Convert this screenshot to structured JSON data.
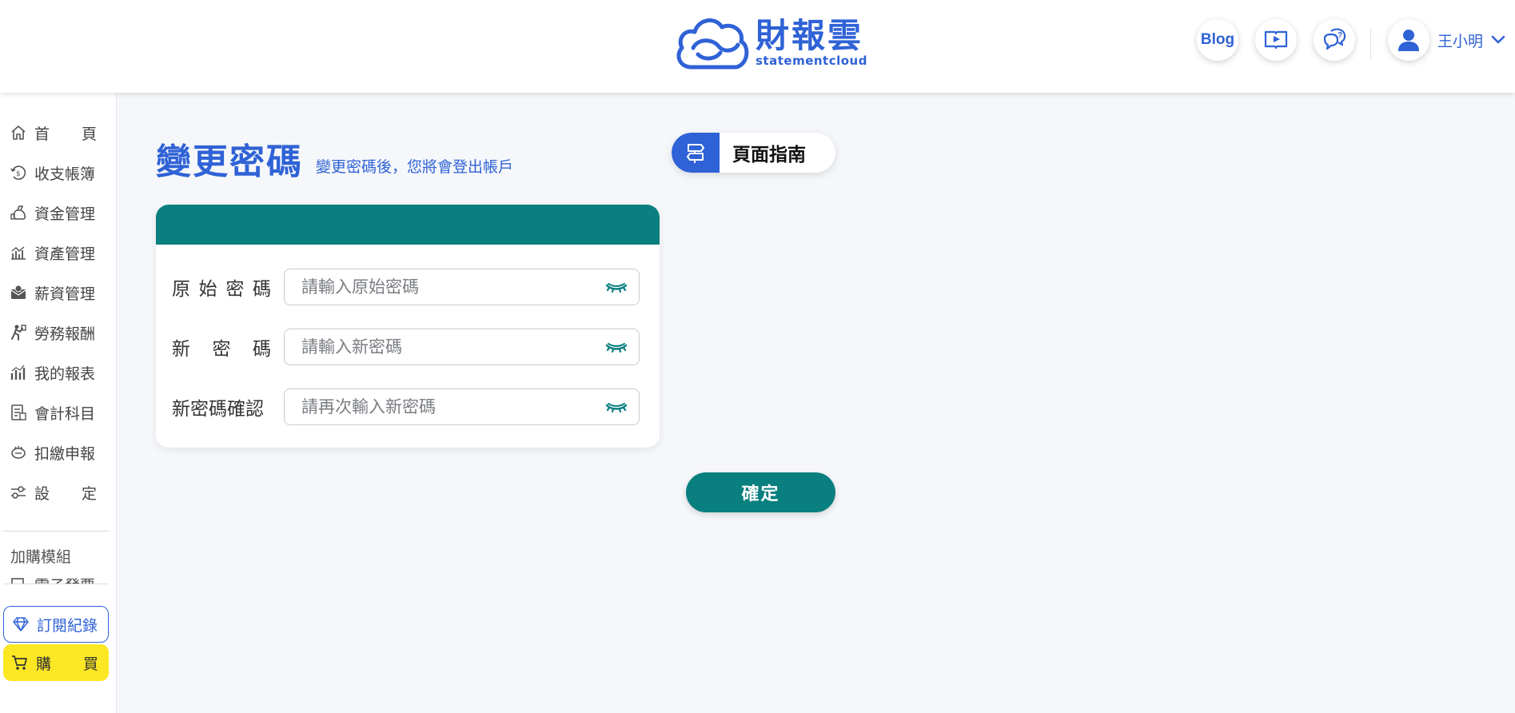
{
  "brand": {
    "name_cn": "財報雲",
    "name_en": "statementcloud",
    "color": "#2f62d6"
  },
  "header": {
    "blog_label": "Blog",
    "user_name": "王小明"
  },
  "sidebar": {
    "items": [
      {
        "label_a": "首",
        "label_b": "頁",
        "icon": "home-icon"
      },
      {
        "label": "收支帳簿",
        "icon": "coin-cycle-icon"
      },
      {
        "label": "資金管理",
        "icon": "money-bag-icon"
      },
      {
        "label": "資產管理",
        "icon": "asset-chart-icon"
      },
      {
        "label": "薪資管理",
        "icon": "salary-envelope-icon"
      },
      {
        "label": "勞務報酬",
        "icon": "worker-icon"
      },
      {
        "label": "我的報表",
        "icon": "bar-chart-icon"
      },
      {
        "label": "會計科目",
        "icon": "ledger-icon"
      },
      {
        "label": "扣繳申報",
        "icon": "piggy-bank-icon"
      },
      {
        "label_a": "設",
        "label_b": "定",
        "icon": "sliders-icon"
      }
    ],
    "section_label": "加購模組",
    "partial_label": "電子發票",
    "subscription_label": "訂閱紀錄",
    "buy_label_a": "購",
    "buy_label_b": "買"
  },
  "main": {
    "title": "變更密碼",
    "subtitle": "變更密碼後，您將會登出帳戶",
    "guide_label": "頁面指南",
    "form": {
      "original": {
        "label_chars": [
          "原",
          "始",
          "密",
          "碼"
        ],
        "placeholder": "請輸入原始密碼",
        "value": ""
      },
      "new": {
        "label_chars": [
          "新",
          "密",
          "碼"
        ],
        "placeholder": "請輸入新密碼",
        "value": ""
      },
      "confirm": {
        "label": "新密碼確認",
        "placeholder": "請再次輸入新密碼",
        "value": ""
      }
    },
    "confirm_button": "確定"
  },
  "colors": {
    "accent_blue": "#2f62d6",
    "teal": "#0a7f7f",
    "buy_yellow": "#fce724",
    "background": "#f5f7fa"
  }
}
